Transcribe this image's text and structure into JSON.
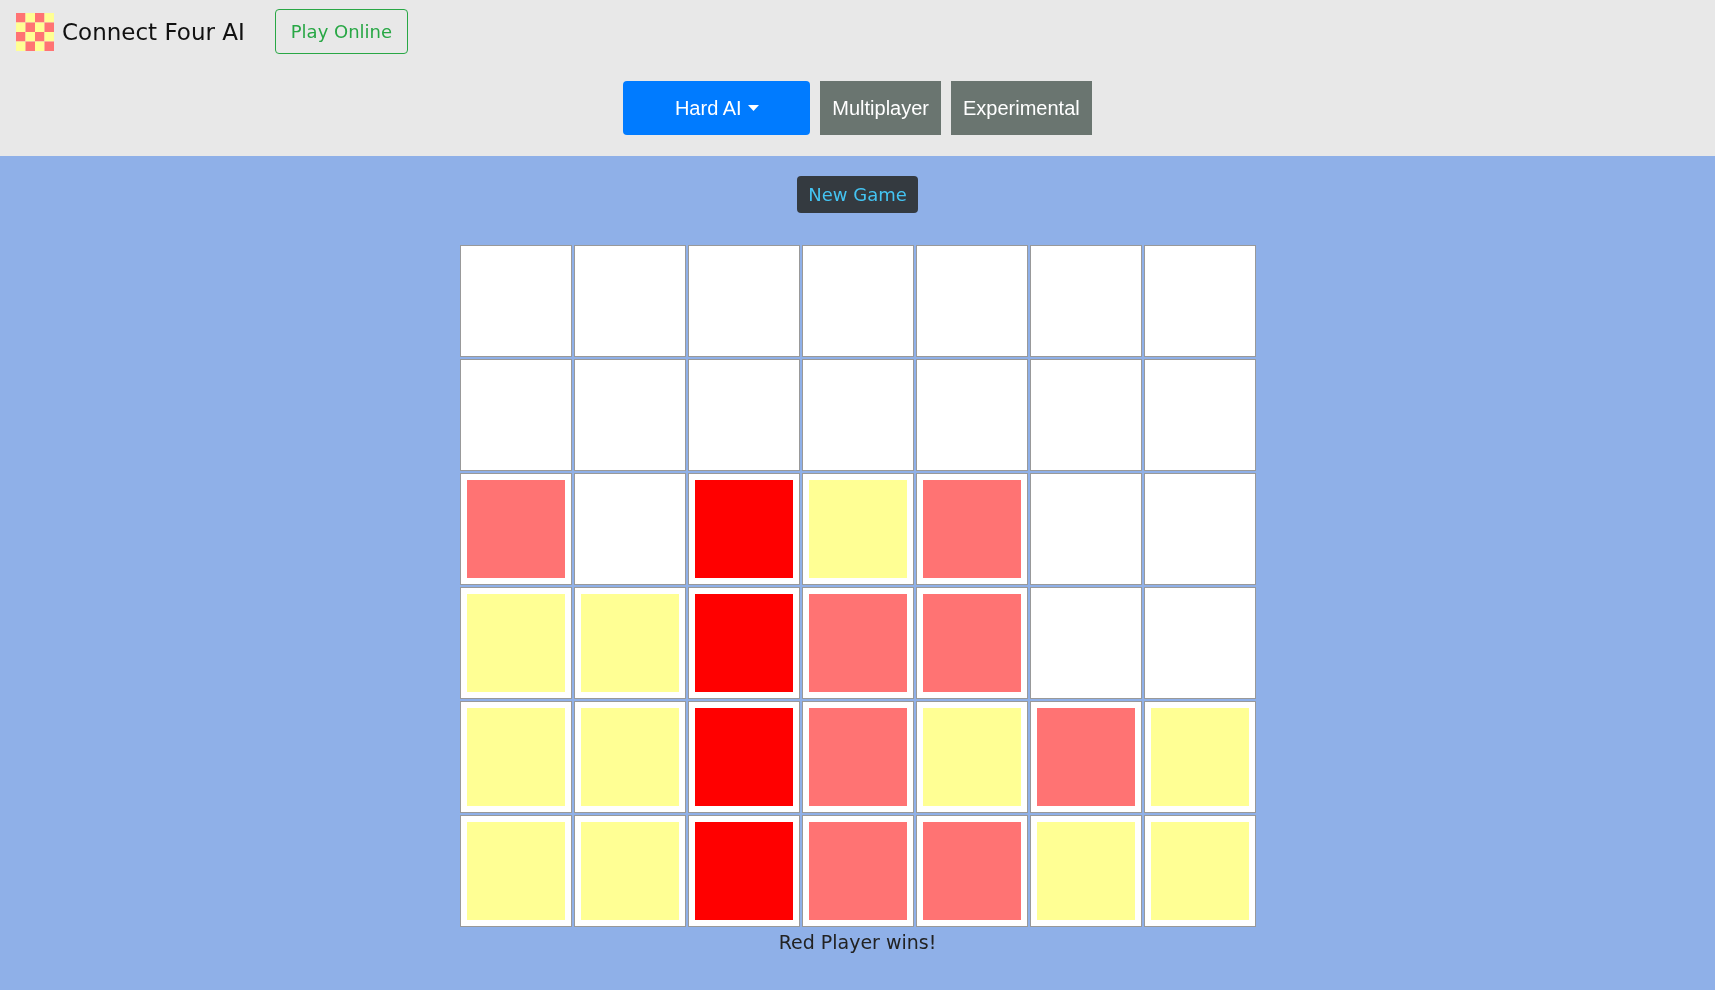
{
  "header": {
    "title": "Connect Four AI",
    "play_online": "Play Online"
  },
  "modes": [
    {
      "label": "Hard AI",
      "kind": "dropdown",
      "selected": true
    },
    {
      "label": "Multiplayer",
      "kind": "button",
      "selected": false
    },
    {
      "label": "Experimental",
      "kind": "button",
      "selected": false
    }
  ],
  "new_game": "New Game",
  "board": {
    "rows": [
      [
        {},
        {},
        {},
        {},
        {},
        {},
        {}
      ],
      [
        {},
        {},
        {},
        {},
        {},
        {},
        {}
      ],
      [
        {
          "color": "#ff7373"
        },
        {},
        {
          "color": "#ff0000"
        },
        {
          "color": "#ffff94"
        },
        {
          "color": "#ff7373"
        },
        {},
        {}
      ],
      [
        {
          "color": "#ffff94"
        },
        {
          "color": "#ffff94"
        },
        {
          "color": "#ff0000"
        },
        {
          "color": "#ff7373"
        },
        {
          "color": "#ff7373"
        },
        {},
        {}
      ],
      [
        {
          "color": "#ffff94"
        },
        {
          "color": "#ffff94"
        },
        {
          "color": "#ff0000"
        },
        {
          "color": "#ff7373"
        },
        {
          "color": "#ffff94"
        },
        {
          "color": "#ff7373"
        },
        {
          "color": "#ffff94"
        }
      ],
      [
        {
          "color": "#ffff94"
        },
        {
          "color": "#ffff94"
        },
        {
          "color": "#ff0000"
        },
        {
          "color": "#ff7373"
        },
        {
          "color": "#ff7373"
        },
        {
          "color": "#ffff94"
        },
        {
          "color": "#ffff94"
        }
      ]
    ]
  },
  "status": "Red Player wins!"
}
